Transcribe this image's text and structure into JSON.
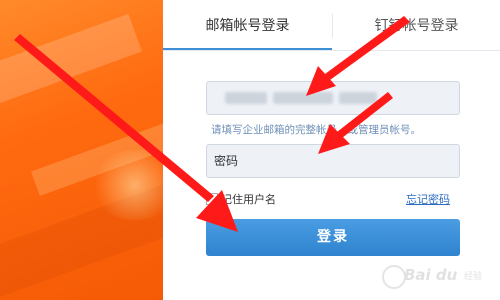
{
  "tabs": {
    "email_login": "邮箱帐号登录",
    "dingtalk_login": "钉钉帐号登录"
  },
  "form": {
    "email_value": "",
    "email_hint": "请填写企业邮箱的完整帐号，或管理员帐号。",
    "password_placeholder": "密码",
    "remember_label": "记住用户名",
    "forgot_label": "忘记密码",
    "login_label": "登录"
  },
  "watermark": {
    "brand": "Bai du",
    "sub": "经验"
  },
  "colors": {
    "accent": "#3d8fd8",
    "annotation_arrow": "#ff1a1a",
    "left_background": "#ff6a10"
  }
}
